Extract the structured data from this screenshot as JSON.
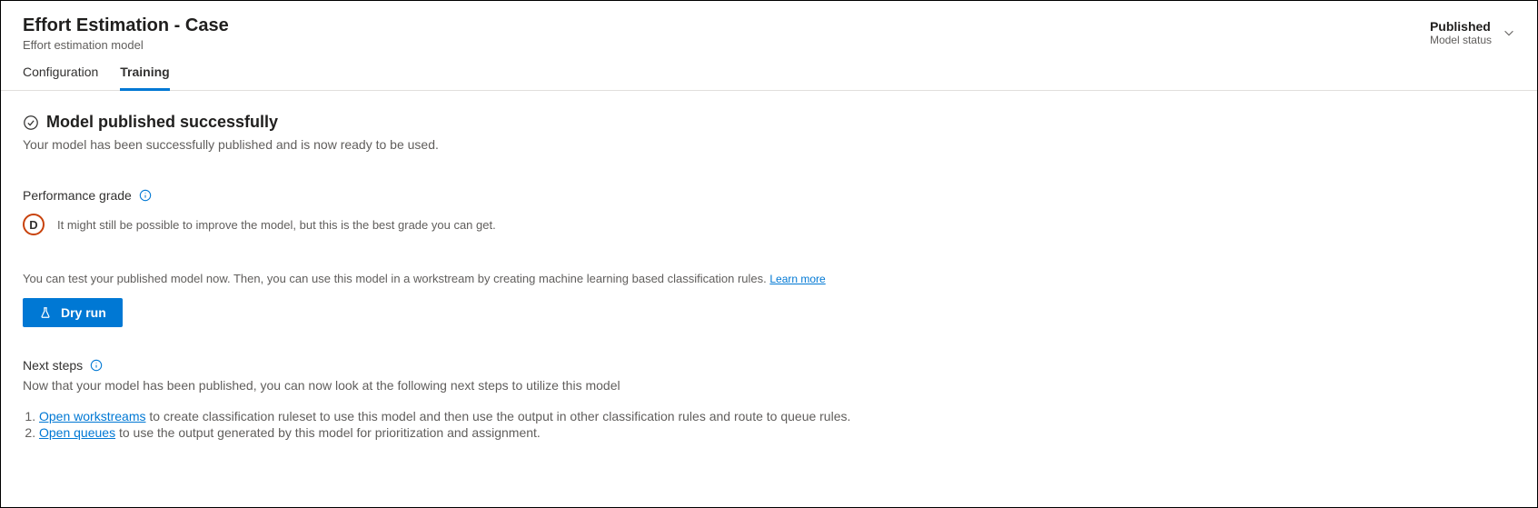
{
  "header": {
    "title": "Effort Estimation - Case",
    "subtitle": "Effort estimation model",
    "status_value": "Published",
    "status_label": "Model status"
  },
  "tabs": {
    "configuration": "Configuration",
    "training": "Training",
    "active": "training"
  },
  "success": {
    "title": "Model published successfully",
    "description": "Your model has been successfully published and is now ready to be used."
  },
  "performance": {
    "label": "Performance grade",
    "grade_letter": "D",
    "grade_description": "It might still be possible to improve the model, but this is the best grade you can get."
  },
  "test": {
    "description": "You can test your published model now. Then, you can use this model in a workstream by creating machine learning based classification rules. ",
    "learn_more": "Learn more",
    "dry_run_label": "Dry run"
  },
  "next_steps": {
    "label": "Next steps",
    "description": "Now that your model has been published, you can now look at the following next steps to utilize this model",
    "step1_link": "Open workstreams",
    "step1_text": " to create classification ruleset to use this model and then use the output in other classification rules and route to queue rules.",
    "step2_link": "Open queues",
    "step2_text": " to use the output generated by this model for prioritization and assignment."
  }
}
